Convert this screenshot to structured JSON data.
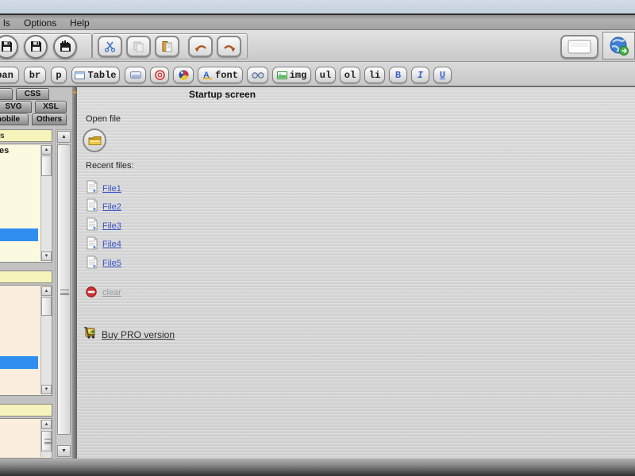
{
  "icons": {
    "up": "▲",
    "down": "▼",
    "plus": "+"
  },
  "menu": {
    "items": [
      {
        "label": "ls"
      },
      {
        "label": "Options"
      },
      {
        "label": "Help"
      }
    ]
  },
  "tagbar": {
    "span": "pan",
    "br": "br",
    "p": "p",
    "table": "Table",
    "font": "font",
    "img": "img",
    "ul": "ul",
    "ol": "ol",
    "li": "li",
    "bold": "B",
    "italic": "I",
    "underline": "U"
  },
  "sidebar": {
    "tabs": [
      {
        "label": "CSS"
      },
      {
        "label": "SVG"
      },
      {
        "label": "XSL"
      },
      {
        "label": "mobile"
      },
      {
        "label": "Others"
      }
    ],
    "section1": {
      "header": "s",
      "first_item": "es"
    },
    "section2": {
      "header": ""
    },
    "section3": {
      "header": ""
    }
  },
  "main": {
    "title": "Startup screen",
    "open_file_label": "Open file",
    "recent_files_label": "Recent files:",
    "recent_files": [
      {
        "label": "File1"
      },
      {
        "label": "File2"
      },
      {
        "label": "File3"
      },
      {
        "label": "File4"
      },
      {
        "label": "File5"
      }
    ],
    "clear_label": "clear",
    "buy_pro_label": "Buy PRO version"
  },
  "colors": {
    "selection_blue": "#2f8ef0",
    "link_blue": "#3853c8",
    "header_yellow": "#f7f4bb",
    "list_yellow": "#fbf9df",
    "list_peach": "#fbeede",
    "accent_orange": "#a8561e",
    "accent_red": "#cc3333"
  }
}
